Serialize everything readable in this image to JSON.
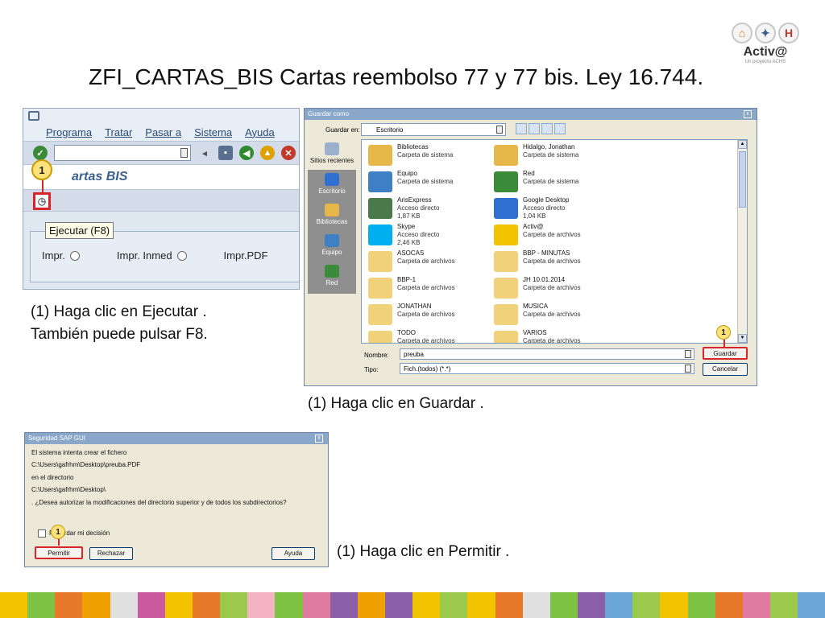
{
  "slide": {
    "title": "ZFI_CARTAS_BIS Cartas reembolso 77 y 77 bis. Ley 16.744.",
    "logo_text": "Activ@",
    "logo_sub": "Un proyecto ACHS",
    "captions": {
      "step1_line1": "(1) Haga clic en Ejecutar  .",
      "step1_line2": "También puede pulsar F8.",
      "step2": "(1) Haga clic en Guardar  .",
      "step3": "(1) Haga clic en Permitir  ."
    },
    "stripe_colors": [
      "#f3c300",
      "#7dc242",
      "#e8782a",
      "#f0a000",
      "#e0e0e0",
      "#c95b9e",
      "#f3c300",
      "#e8782a",
      "#9bc94b",
      "#f3b2c1",
      "#7dc242",
      "#e07a9e",
      "#8b5ea8",
      "#f0a000",
      "#8b5ea8",
      "#f3c300",
      "#9bc94b",
      "#f3c300",
      "#e8782a",
      "#e0e0e0",
      "#7dc242",
      "#8b5ea8",
      "#6aa6d8",
      "#9bc94b",
      "#f3c300",
      "#7dc242",
      "#e8782a",
      "#e07a9e",
      "#9bc94b",
      "#6aa6d8"
    ]
  },
  "sap_window": {
    "menu": [
      "Programa",
      "Tratar",
      "Pasar a",
      "Sistema",
      "Ayuda"
    ],
    "heading": "artas BIS",
    "tooltip": "Ejecutar   (F8)",
    "step_badge": "1",
    "radio_options": [
      "Impr.",
      "Impr. Inmed",
      "Impr.PDF"
    ]
  },
  "save_dialog": {
    "title": "Guardar como",
    "look_in_label": "Guardar en:",
    "look_in_value": "Escritorio",
    "places": [
      "Sitios recientes",
      "Escritorio",
      "Bibliotecas",
      "Equipo",
      "Red"
    ],
    "files": [
      {
        "name": "Bibliotecas",
        "type": "Carpeta de sistema",
        "size": "",
        "color": "#e6b84a"
      },
      {
        "name": "Hidalgo, Jonathan",
        "type": "Carpeta de sistema",
        "size": "",
        "color": "#e6b84a"
      },
      {
        "name": "Equipo",
        "type": "Carpeta de sistema",
        "size": "",
        "color": "#3f7fc4"
      },
      {
        "name": "Red",
        "type": "Carpeta de sistema",
        "size": "",
        "color": "#3b8b3b"
      },
      {
        "name": "ArisExpress",
        "type": "Acceso directo",
        "size": "1,87 KB",
        "color": "#4a7a4a"
      },
      {
        "name": "Google Desktop",
        "type": "Acceso directo",
        "size": "1,04 KB",
        "color": "#2f6fd0"
      },
      {
        "name": "Skype",
        "type": "Acceso directo",
        "size": "2,46 KB",
        "color": "#00aff0"
      },
      {
        "name": "Activ@",
        "type": "Carpeta de archivos",
        "size": "",
        "color": "#f3c300"
      },
      {
        "name": "ASOCAS",
        "type": "Carpeta de archivos",
        "size": "",
        "color": "#f0d27a"
      },
      {
        "name": "BBP - MINUTAS",
        "type": "Carpeta de archivos",
        "size": "",
        "color": "#f0d27a"
      },
      {
        "name": "BBP-1",
        "type": "Carpeta de archivos",
        "size": "",
        "color": "#f0d27a"
      },
      {
        "name": "JH 10.01.2014",
        "type": "Carpeta de archivos",
        "size": "",
        "color": "#f0d27a"
      },
      {
        "name": "JONATHAN",
        "type": "Carpeta de archivos",
        "size": "",
        "color": "#f0d27a"
      },
      {
        "name": "MUSICA",
        "type": "Carpeta de archivos",
        "size": "",
        "color": "#f0d27a"
      },
      {
        "name": "TODO",
        "type": "Carpeta de archivos",
        "size": "",
        "color": "#f0d27a"
      },
      {
        "name": "VARIOS",
        "type": "Carpeta de archivos",
        "size": "",
        "color": "#f0d27a"
      }
    ],
    "filename_label": "Nombre:",
    "filename_value": "preuba",
    "filetype_label": "Tipo:",
    "filetype_value": "Fich.(todos) (*.*)",
    "save_button": "Guardar",
    "cancel_button": "Cancelar",
    "step_badge": "1"
  },
  "security_dialog": {
    "title": "Seguridad SAP GUI",
    "line1": "El sistema intenta crear el fichero",
    "line2": "C:\\Users\\gafrhm\\Desktop\\preuba.PDF",
    "line3": "en el directorio",
    "line4": "C:\\Users\\gafrhm\\Desktop\\",
    "line5": ". ¿Desea autorizar la modificaciones del directorio superior y de todos los subdirectorios?",
    "remember_label": "Recordar mi decisión",
    "allow_button": "Permitir",
    "deny_button": "Rechazar",
    "help_button": "Ayuda",
    "step_badge": "1"
  }
}
